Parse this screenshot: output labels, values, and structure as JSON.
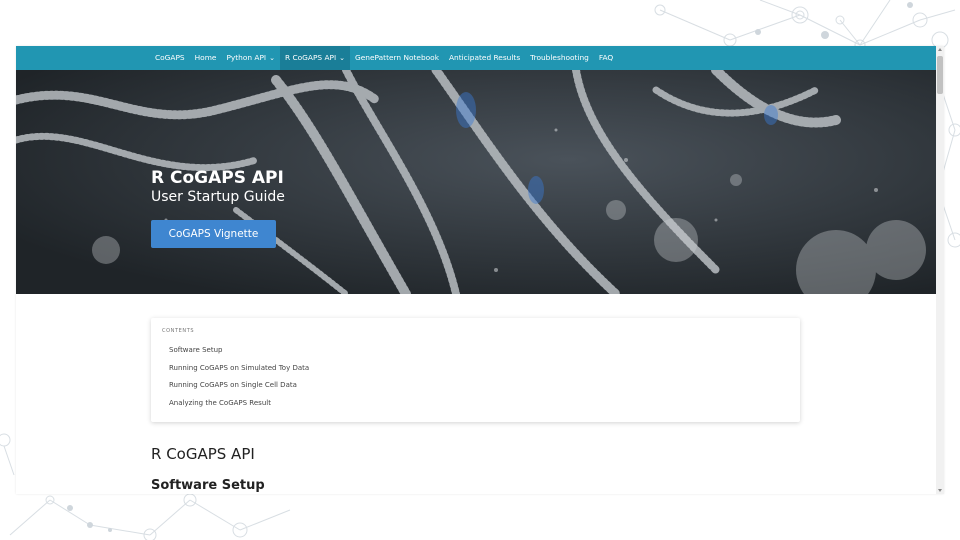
{
  "nav": {
    "items": [
      {
        "label": "CoGAPS",
        "dropdown": false,
        "active": false
      },
      {
        "label": "Home",
        "dropdown": false,
        "active": false
      },
      {
        "label": "Python API",
        "dropdown": true,
        "active": false
      },
      {
        "label": "R CoGAPS API",
        "dropdown": true,
        "active": true
      },
      {
        "label": "GenePattern Notebook",
        "dropdown": false,
        "active": false
      },
      {
        "label": "Anticipated Results",
        "dropdown": false,
        "active": false
      },
      {
        "label": "Troubleshooting",
        "dropdown": false,
        "active": false
      },
      {
        "label": "FAQ",
        "dropdown": false,
        "active": false
      }
    ],
    "color": "#2196b2"
  },
  "hero": {
    "title": "R CoGAPS API",
    "subtitle": "User Startup Guide",
    "button_label": "CoGAPS Vignette",
    "button_color": "#3f86d0"
  },
  "toc": {
    "label": "CONTENTS",
    "items": [
      "Software Setup",
      "Running CoGAPS on Simulated Toy Data",
      "Running CoGAPS on Single Cell Data",
      "Analyzing the CoGAPS Result"
    ]
  },
  "content": {
    "section_title": "R CoGAPS API",
    "subsection_title": "Software Setup"
  }
}
